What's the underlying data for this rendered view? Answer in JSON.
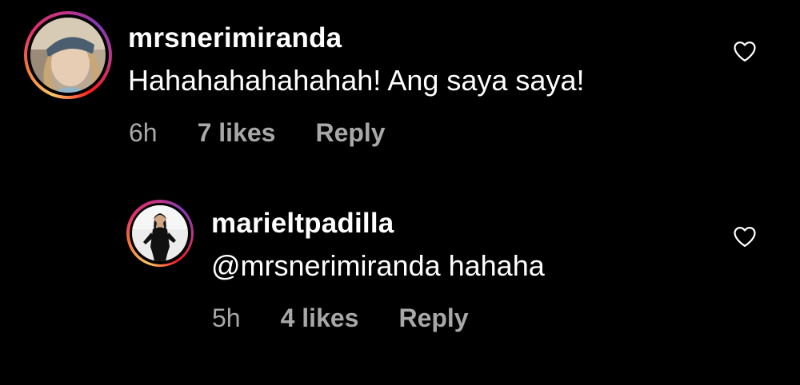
{
  "comments": [
    {
      "username": "mrsnerimiranda",
      "text": "Hahahahahahahah! Ang saya saya!",
      "time": "6h",
      "likes": "7 likes",
      "reply_label": "Reply",
      "avatar": "profile-photo-woman-with-headband",
      "heart_icon": "heart-outline-icon"
    },
    {
      "username": "marieltpadilla",
      "text": "@mrsnerimiranda hahaha",
      "time": "5h",
      "likes": "4 likes",
      "reply_label": "Reply",
      "avatar": "profile-photo-woman-in-black-outfit",
      "heart_icon": "heart-outline-icon"
    }
  ],
  "colors": {
    "background": "#000000",
    "text_primary": "#ffffff",
    "text_secondary": "#a8a8a8",
    "story_ring_gradient": [
      "#fdc468",
      "#f77737",
      "#e1306c",
      "#c13584",
      "#833ab4"
    ]
  }
}
